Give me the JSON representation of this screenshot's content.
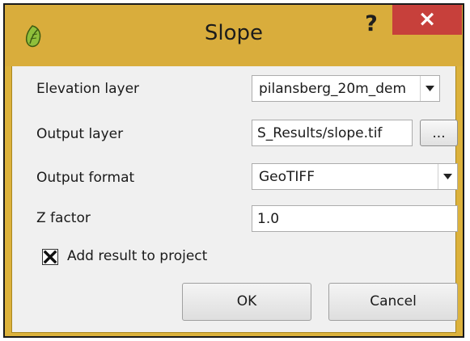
{
  "window": {
    "title": "Slope",
    "help_label": "?",
    "close_label": "×"
  },
  "form": {
    "elevation_layer": {
      "label": "Elevation layer",
      "value": "pilansberg_20m_dem"
    },
    "output_layer": {
      "label": "Output layer",
      "value": "S_Results/slope.tif",
      "browse_label": "..."
    },
    "output_format": {
      "label": "Output format",
      "value": "GeoTIFF"
    },
    "z_factor": {
      "label": "Z factor",
      "value": "1.0"
    },
    "add_to_project": {
      "label": "Add result to project",
      "checked": true
    }
  },
  "buttons": {
    "ok": "OK",
    "cancel": "Cancel"
  },
  "icons": {
    "app": "qgis-icon",
    "dropdown": "chevron-down-icon",
    "check": "check-mark-icon"
  },
  "colors": {
    "titlebar": "#d9ad3c",
    "close_button": "#c7403b",
    "client_bg": "#f0f0f0"
  }
}
